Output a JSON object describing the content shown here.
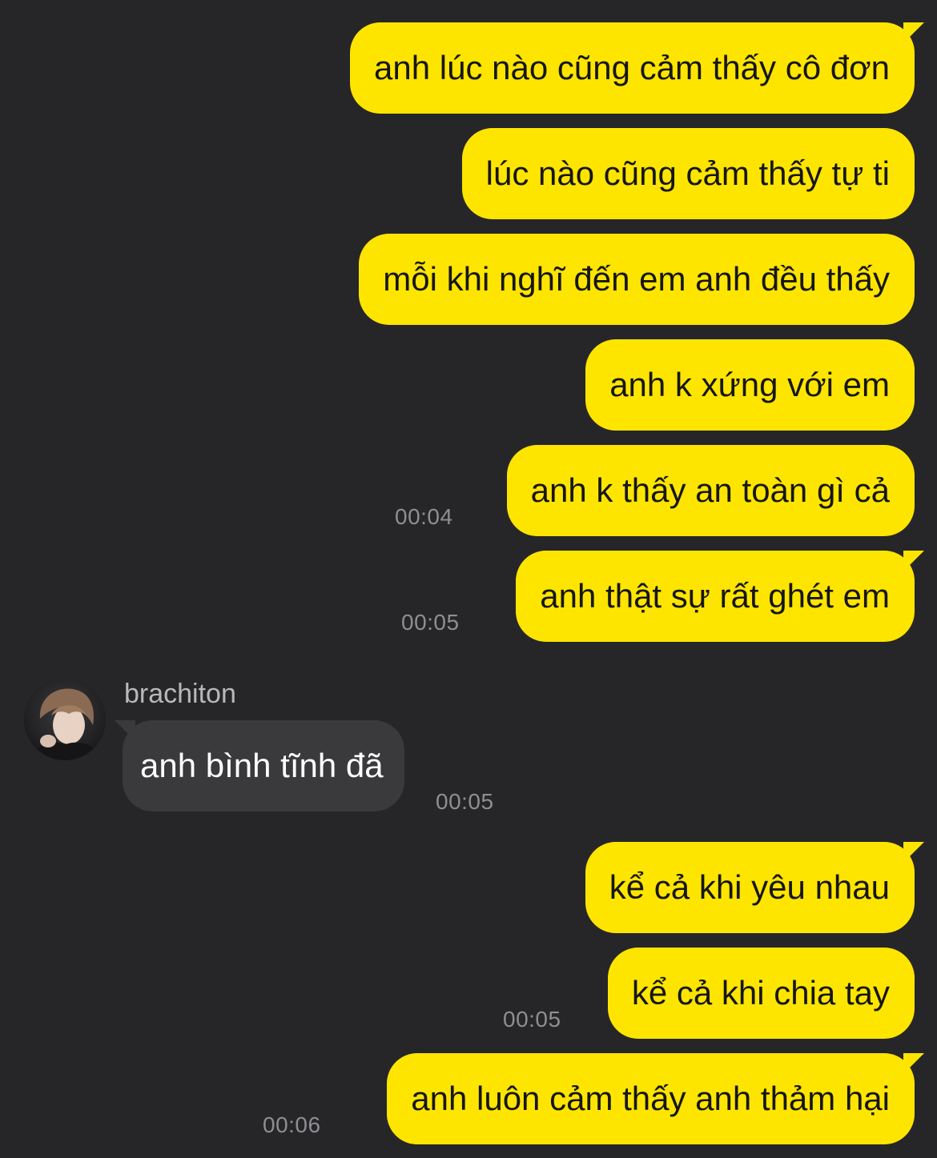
{
  "messages_sent_1": [
    {
      "text": "anh lúc nào cũng cảm thấy cô đơn"
    },
    {
      "text": "lúc nào cũng cảm thấy tự ti"
    },
    {
      "text": "mỗi khi nghĩ đến em anh đều thấy"
    },
    {
      "text": "anh k xứng với em"
    },
    {
      "text": "anh k thấy an toàn gì cả",
      "time": "00:04"
    },
    {
      "text": "anh thật sự rất ghét em",
      "time": "00:05"
    }
  ],
  "received": {
    "sender": "brachiton",
    "avatar_icon": "profile-photo",
    "text": "anh bình tĩnh đã",
    "time": "00:05"
  },
  "messages_sent_2": [
    {
      "text": "kể cả khi yêu nhau"
    },
    {
      "text": "kể cả khi chia tay",
      "time": "00:05"
    },
    {
      "text": "anh luôn cảm thấy anh thảm hại",
      "time": "00:06"
    }
  ],
  "colors": {
    "background": "#262628",
    "sent_bubble": "#FEE500",
    "received_bubble": "#3A3A3C",
    "timestamp": "#8E8E93"
  }
}
